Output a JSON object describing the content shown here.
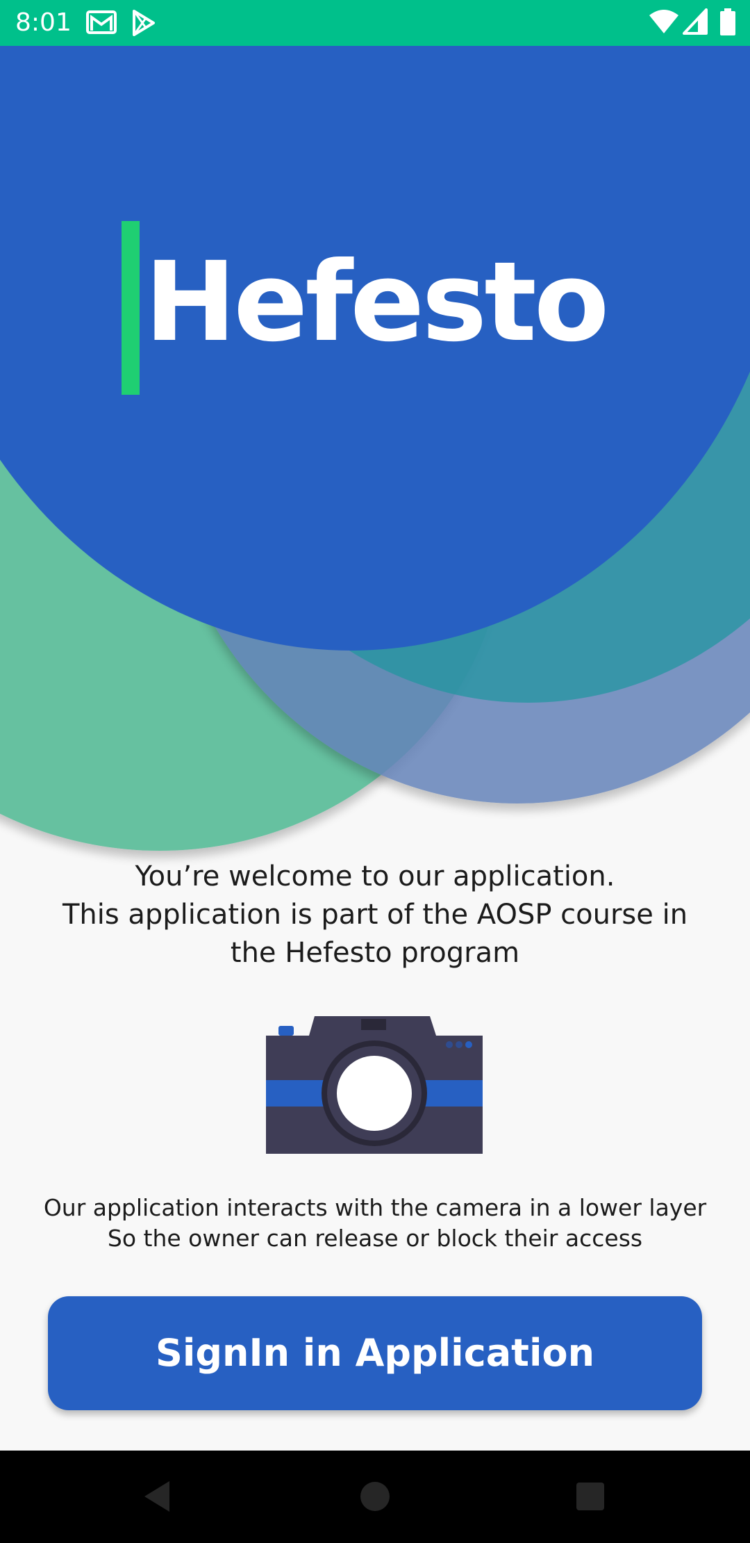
{
  "status_bar": {
    "time": "8:01",
    "background_color": "#00c08b",
    "left_icons": [
      "gmail-icon",
      "play-store-icon"
    ],
    "right_icons": [
      "wifi-icon",
      "signal-icon",
      "battery-icon"
    ]
  },
  "hero": {
    "brand_title": "Hefesto",
    "accent_color": "#1fcf72",
    "primary_color": "#2760c2"
  },
  "welcome": {
    "line1": "You’re welcome to our application.",
    "line2": "This application is part of the AOSP course in",
    "line3": "the Hefesto program"
  },
  "illustration": {
    "icon": "camera-icon"
  },
  "description": {
    "line1": "Our application interacts with the camera in a lower layer",
    "line2": "So the owner can release or block their access"
  },
  "signin_button": {
    "label": "SignIn in Application"
  },
  "nav_bar": {
    "icons": [
      "back-icon",
      "home-icon",
      "recents-icon"
    ]
  }
}
